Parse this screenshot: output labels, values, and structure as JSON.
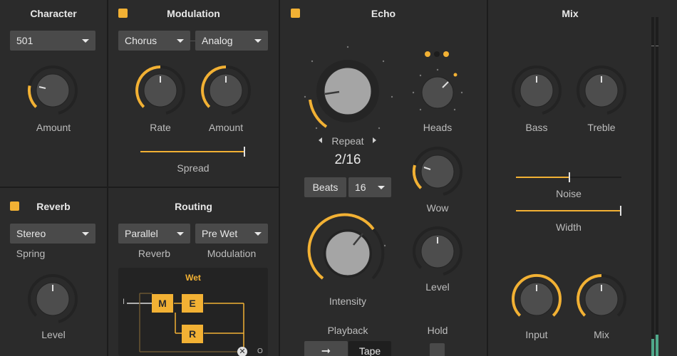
{
  "character": {
    "title": "Character",
    "preset": "501",
    "amount_label": "Amount"
  },
  "modulation": {
    "title": "Modulation",
    "type": "Chorus",
    "mode": "Analog",
    "rate_label": "Rate",
    "amount_label": "Amount",
    "spread_label": "Spread",
    "spread_level": 0.98
  },
  "echo": {
    "title": "Echo",
    "repeat_label": "Repeat",
    "repeat_value": "2/16",
    "beats_label": "Beats",
    "beats_value": "16",
    "heads_label": "Heads",
    "wow_label": "Wow",
    "intensity_label": "Intensity",
    "level_label": "Level",
    "playback_label": "Playback",
    "playback_tape_label": "Tape",
    "hold_label": "Hold"
  },
  "mix": {
    "title": "Mix",
    "bass_label": "Bass",
    "treble_label": "Treble",
    "noise_label": "Noise",
    "noise_level": 0.5,
    "width_label": "Width",
    "width_level": 1.0,
    "input_label": "Input",
    "mix_label": "Mix"
  },
  "reverb": {
    "title": "Reverb",
    "type": "Stereo",
    "subtype_label": "Spring",
    "level_label": "Level"
  },
  "routing": {
    "title": "Routing",
    "mode": "Parallel",
    "position": "Pre Wet",
    "reverb_label": "Reverb",
    "modulation_label": "Modulation",
    "wet_label": "Wet",
    "node_m": "M",
    "node_e": "E",
    "node_r": "R",
    "in_label": "I",
    "out_label": "O"
  },
  "colors": {
    "accent": "#f2b134",
    "background": "#2e2e2e",
    "control": "#4a4a4a"
  }
}
